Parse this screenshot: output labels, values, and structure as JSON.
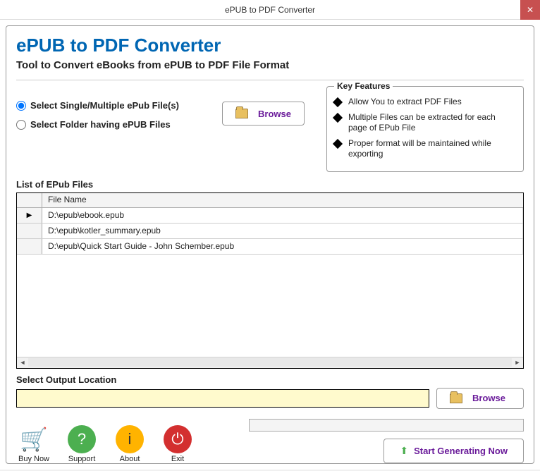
{
  "window": {
    "title": "ePUB to PDF Converter"
  },
  "header": {
    "title": "ePUB to PDF Converter",
    "subtitle": "Tool to Convert eBooks from ePUB to PDF File Format"
  },
  "radios": {
    "single": "Select Single/Multiple ePub File(s)",
    "folder": "Select Folder having ePUB Files"
  },
  "browse_label": "Browse",
  "features": {
    "title": "Key Features",
    "items": [
      "Allow You to extract PDF Files",
      "Multiple Files can be extracted for each page of EPub File",
      "Proper format will be maintained while exporting"
    ]
  },
  "grid": {
    "label": "List of EPub Files",
    "column": "File Name",
    "rows": [
      "D:\\epub\\ebook.epub",
      "D:\\epub\\kotler_summary.epub",
      "D:\\epub\\Quick Start Guide - John Schember.epub"
    ]
  },
  "output": {
    "label": "Select  Output Location",
    "value": "",
    "browse": "Browse"
  },
  "actions": {
    "buy": "Buy Now",
    "support": "Support",
    "about": "About",
    "exit": "Exit"
  },
  "start": "Start Generating Now"
}
